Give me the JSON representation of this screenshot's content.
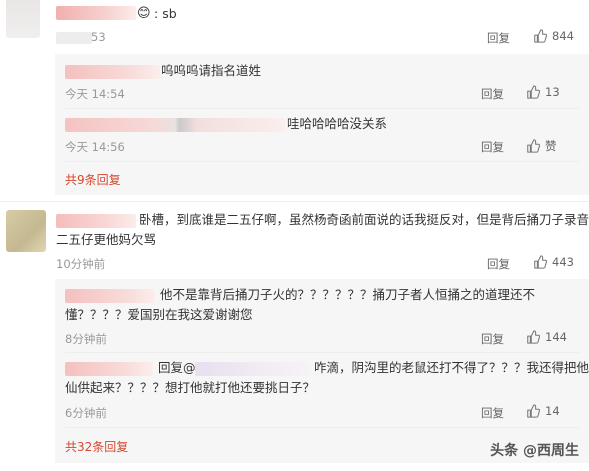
{
  "comments": [
    {
      "text_suffix": "sb",
      "time": "53",
      "reply_label": "回复",
      "likes": "844"
    },
    {
      "text_line1": "卧槽，到底谁是二五仔啊，虽然杨奇函前面说的话我挺反对，但是背后捅刀子录音",
      "text_line2": "二五仔更他妈欠骂",
      "time": "10分钟前",
      "reply_label": "回复",
      "likes": "443"
    }
  ],
  "replies_a": [
    {
      "text": "呜呜呜请指名道姓",
      "time": "今天 14:54",
      "reply_label": "回复",
      "likes": "13"
    },
    {
      "text": "哇哈哈哈哈没关系",
      "time": "今天 14:56",
      "reply_label": "回复",
      "likes": "赞"
    }
  ],
  "replies_b": [
    {
      "line1": "他不是靠背后捅刀子火的？？？？？？捅刀子者人恒捅之的道理还不",
      "line2": "懂？？？？爱国别在我这爱谢谢您",
      "time": "8分钟前",
      "reply_label": "回复",
      "likes": "144"
    },
    {
      "prefix": "回复@",
      "line1": "咋滴，阴沟里的老鼠还打不得了？？？我还得把他当神",
      "line2": "仙供起来？？？？想打他就打他还要挑日子？",
      "time": "6分钟前",
      "reply_label": "回复",
      "likes": "14"
    }
  ],
  "more_a": "共9条回复",
  "more_b": "共32条回复",
  "watermark": "头条 @西周生"
}
